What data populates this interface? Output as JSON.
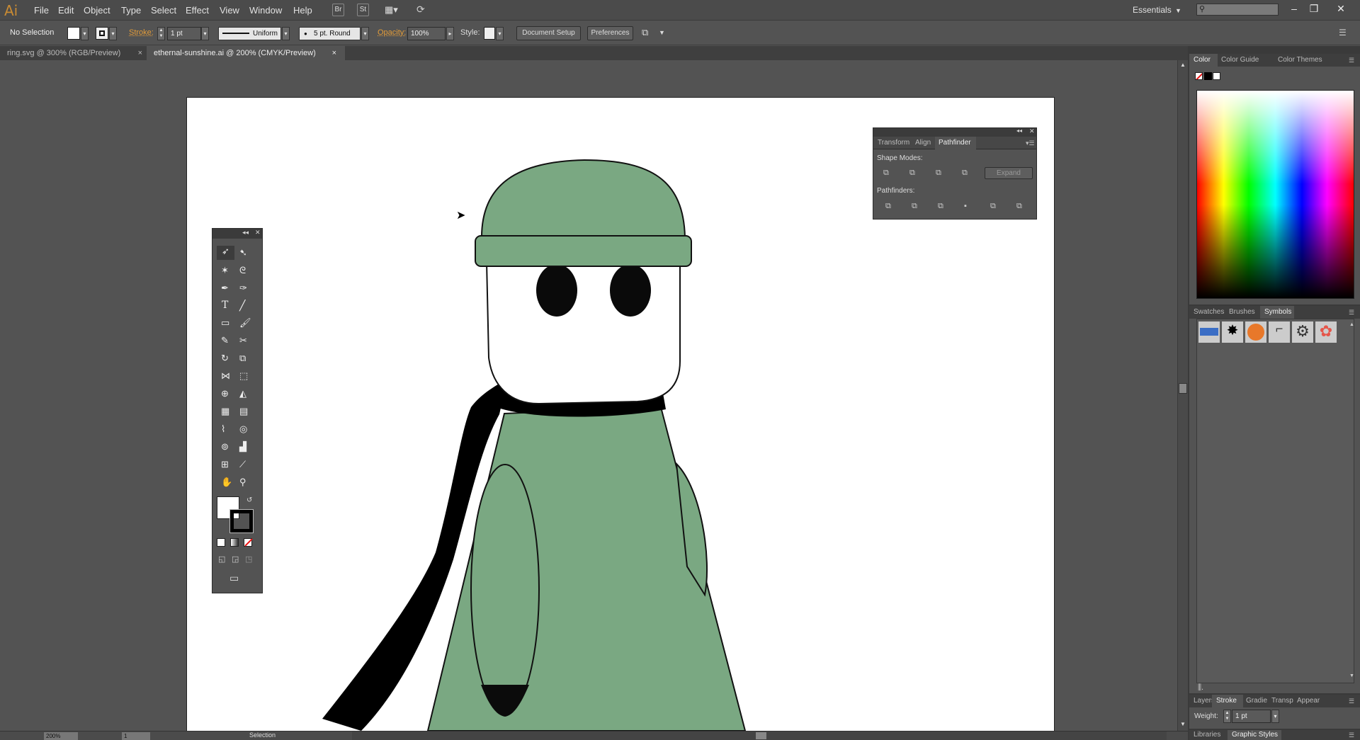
{
  "app": {
    "logo": "Ai"
  },
  "menu": [
    "File",
    "Edit",
    "Object",
    "Type",
    "Select",
    "Effect",
    "View",
    "Window",
    "Help"
  ],
  "menu_buttons": {
    "br": "Br",
    "st": "St"
  },
  "workspace": {
    "label": "Essentials"
  },
  "control": {
    "selection": "No Selection",
    "stroke_label": "Stroke:",
    "stroke_weight": "1 pt",
    "profile": "Uniform",
    "brush": "5 pt. Round",
    "opacity_label": "Opacity:",
    "opacity": "100%",
    "style_label": "Style:",
    "doc_setup": "Document Setup",
    "preferences": "Preferences"
  },
  "tabs": [
    {
      "label": "ring.svg @ 300% (RGB/Preview)",
      "active": false
    },
    {
      "label": "ethernal-sunshine.ai @ 200% (CMYK/Preview)",
      "active": true
    }
  ],
  "pathfinder": {
    "tabs": [
      "Transform",
      "Align",
      "Pathfinder"
    ],
    "shape_modes": "Shape Modes:",
    "expand": "Expand",
    "pathfinders": "Pathfinders:"
  },
  "dock": {
    "color_tabs": [
      "Color",
      "Color Guide",
      "Color Themes"
    ],
    "symbol_tabs": [
      "Swatches",
      "Brushes",
      "Symbols"
    ],
    "stroke_tabs": [
      "Layers",
      "Stroke",
      "Gradie",
      "Transp",
      "Appear"
    ],
    "weight_label": "Weight:",
    "weight": "1 pt",
    "bottom_tabs": [
      "Libraries",
      "Graphic Styles"
    ]
  },
  "status": {
    "zoom": "200%",
    "page": "1",
    "tool": "Selection"
  },
  "colors": {
    "fill": "#7aa882",
    "accent": "#e29c3a"
  }
}
